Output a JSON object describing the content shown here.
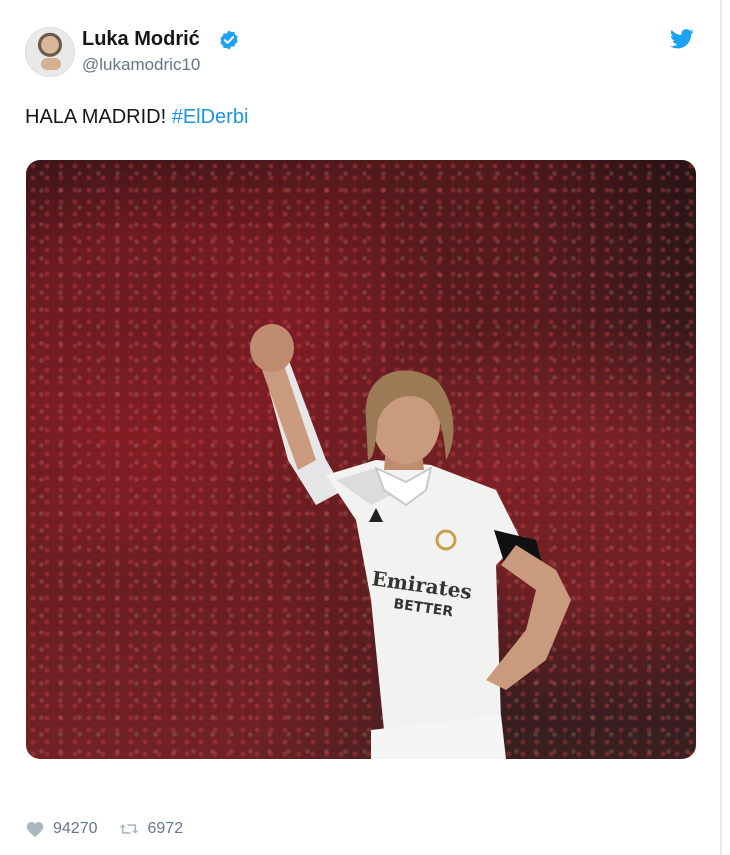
{
  "tweet": {
    "author": {
      "name": "Luka Modrić",
      "handle": "@lukamodric10",
      "verified": true
    },
    "text": "HALA MADRID! ",
    "hashtag": "#ElDerbi",
    "media": {
      "kit_text_line1": "Emirates",
      "kit_text_line2": "BETTER"
    },
    "stats": {
      "likes": "94270",
      "retweets": "6972"
    }
  },
  "icons": {
    "verified": "verified-badge-icon",
    "platform": "twitter-bird-icon",
    "like": "heart-icon",
    "retweet": "retweet-icon"
  },
  "colors": {
    "hashtag": "#1b95e0",
    "verified": "#1da1f2",
    "twitter_blue": "#1da1f2",
    "muted": "#657786",
    "text": "#14171a"
  }
}
